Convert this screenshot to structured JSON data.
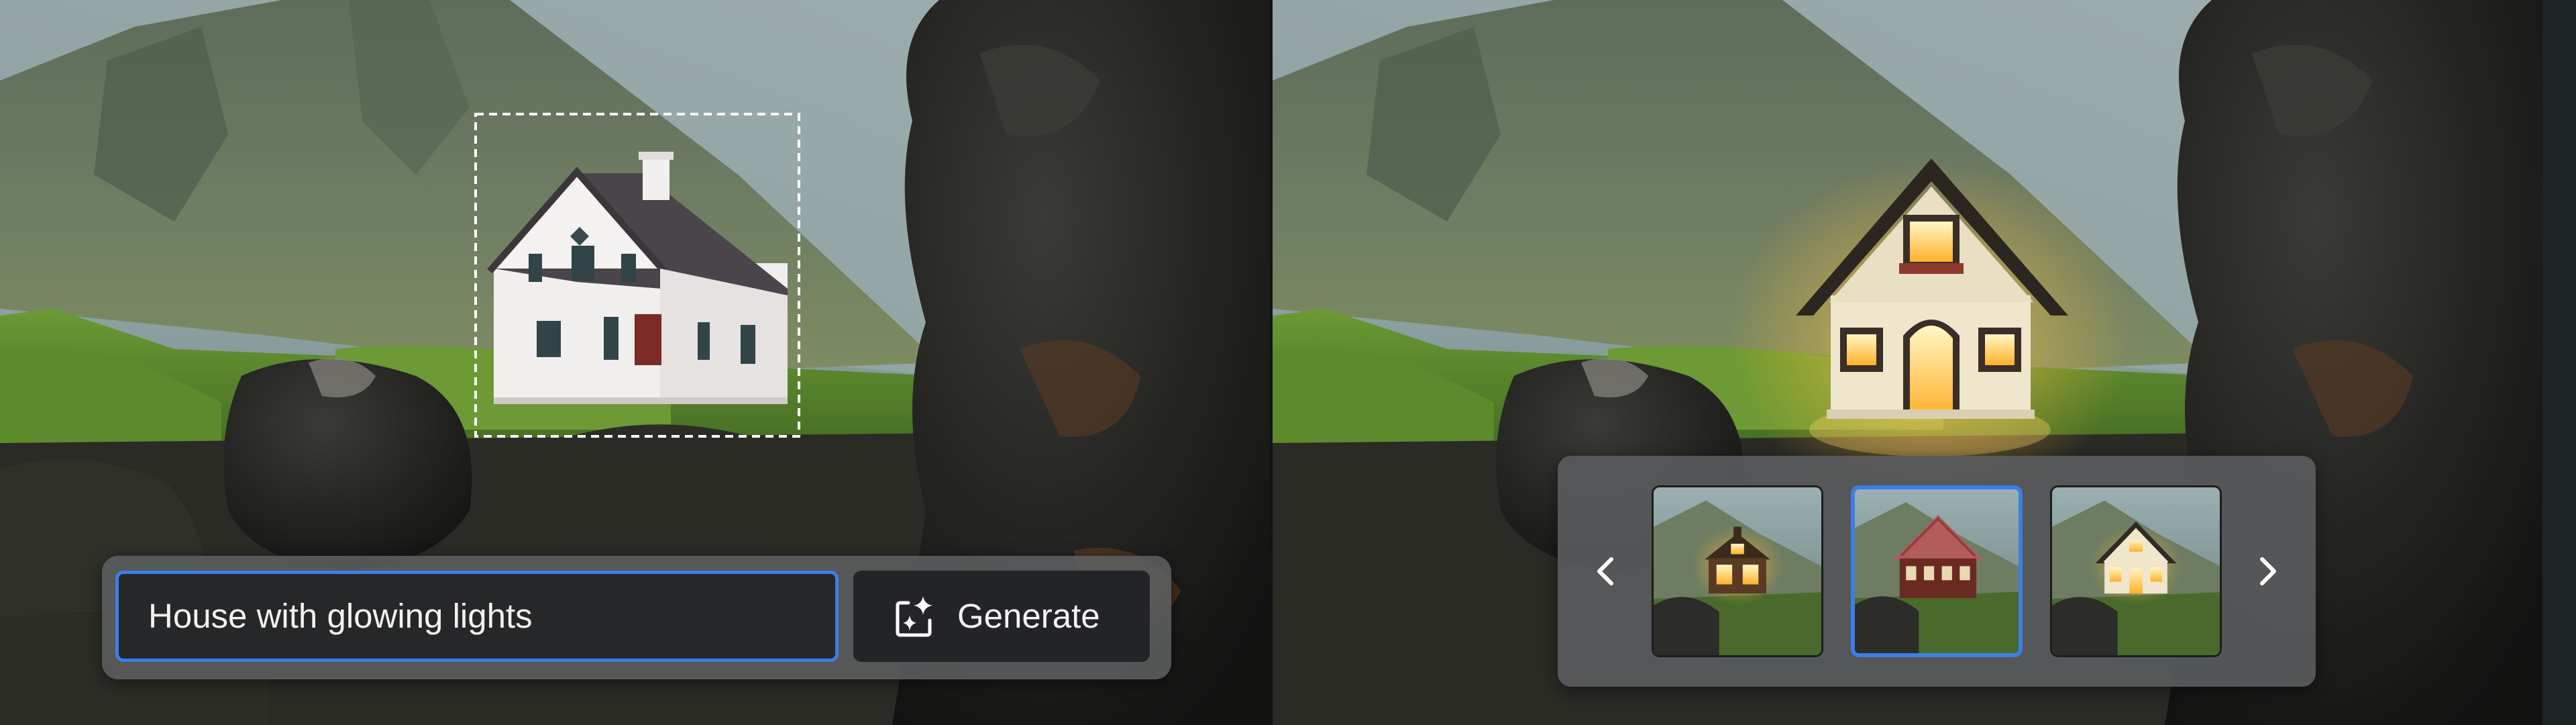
{
  "prompt_bar": {
    "input_value": "House with glowing lights",
    "generate_label": "Generate"
  },
  "variations": {
    "count": 3,
    "selected_index": 1,
    "items": [
      {
        "depicts": "small wooden cabin with glowing windows"
      },
      {
        "depicts": "red wooden house with metal roof"
      },
      {
        "depicts": "white cottage with glowing lights"
      }
    ]
  },
  "icons": {
    "generate": "sparkle-frame-icon",
    "previous": "chevron-left-icon",
    "next": "chevron-right-icon",
    "selection": "marquee-selection"
  },
  "colors": {
    "accent": "#3b7ee6",
    "bar_background": "#5c5e60",
    "input_background": "#262729",
    "text": "#f2f2f2"
  }
}
